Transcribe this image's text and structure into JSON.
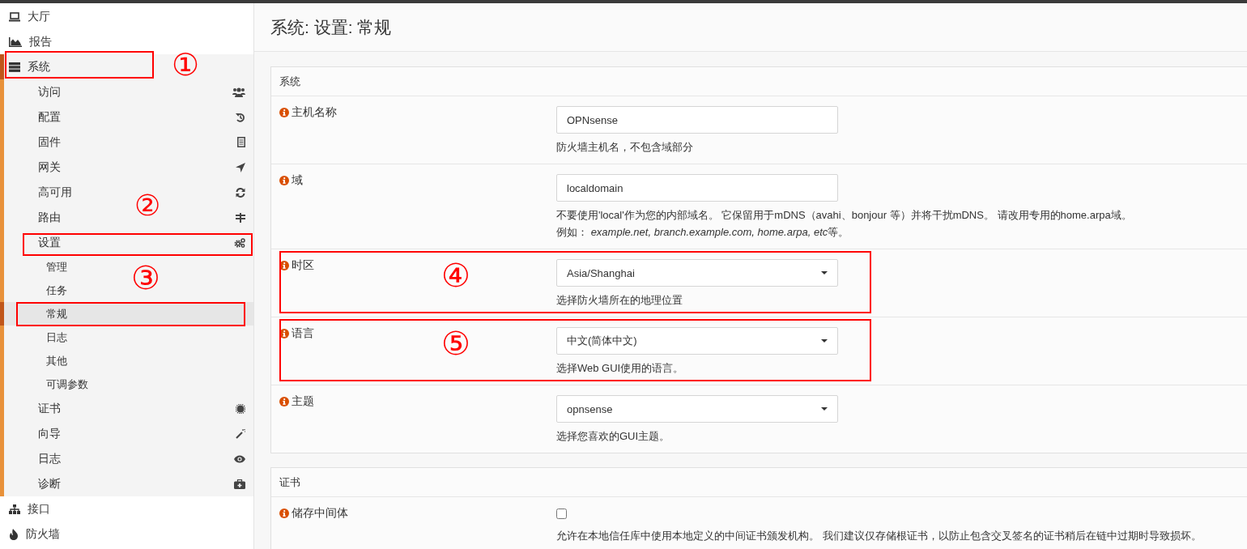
{
  "sidebar": {
    "items": [
      {
        "label": "大厅",
        "selected": false
      },
      {
        "label": "报告",
        "selected": false
      },
      {
        "label": "系统",
        "selected": true,
        "expanded": true,
        "callout": "①",
        "children": [
          {
            "label": "访问",
            "selected": false
          },
          {
            "label": "配置",
            "selected": false
          },
          {
            "label": "固件",
            "selected": false
          },
          {
            "label": "网关",
            "selected": false
          },
          {
            "label": "高可用",
            "selected": false
          },
          {
            "label": "路由",
            "selected": false
          },
          {
            "label": "设置",
            "selected": false,
            "expanded": true,
            "callout": "②",
            "children": [
              {
                "label": "管理",
                "selected": false
              },
              {
                "label": "任务",
                "selected": false
              },
              {
                "label": "常规",
                "selected": true,
                "callout": "③"
              },
              {
                "label": "日志",
                "selected": false
              },
              {
                "label": "其他",
                "selected": false
              },
              {
                "label": "可调参数",
                "selected": false
              }
            ]
          },
          {
            "label": "证书",
            "selected": false
          },
          {
            "label": "向导",
            "selected": false
          },
          {
            "label": "日志",
            "selected": false
          },
          {
            "label": "诊断",
            "selected": false
          }
        ]
      },
      {
        "label": "接口",
        "selected": false
      },
      {
        "label": "防火墙",
        "selected": false
      }
    ]
  },
  "page_title": "系统: 设置: 常规",
  "sections": [
    {
      "title": "系统",
      "rows": [
        {
          "label": "主机名称",
          "kind": "text",
          "value": "OPNsense",
          "help": [
            "防火墙主机名，不包含域部分"
          ]
        },
        {
          "label": "域",
          "kind": "text",
          "value": "localdomain",
          "help": [
            "不要使用'local'作为您的内部域名。 它保留用于mDNS（avahi、bonjour 等）并将干扰mDNS。 请改用专用的home.arpa域。",
            {
              "parts": [
                {
                  "text": "例如： ",
                  "italic": false
                },
                {
                  "text": "example.net, branch.example.com, home.arpa, etc",
                  "italic": true
                },
                {
                  "text": "等。",
                  "italic": false
                }
              ]
            }
          ]
        },
        {
          "label": "时区",
          "kind": "select",
          "value": "Asia/Shanghai",
          "callout": "④",
          "help": [
            "选择防火墙所在的地理位置"
          ]
        },
        {
          "label": "语言",
          "kind": "select",
          "value": "中文(简体中文)",
          "callout": "⑤",
          "help": [
            "选择Web GUI使用的语言。"
          ]
        },
        {
          "label": "主题",
          "kind": "select",
          "value": "opnsense",
          "help": [
            "选择您喜欢的GUI主题。"
          ]
        }
      ]
    },
    {
      "title": "证书",
      "rows": [
        {
          "label": "储存中间体",
          "kind": "checkbox",
          "checked": false,
          "help": [
            "允许在本地信任库中使用本地定义的中间证书颁发机构。 我们建议仅存储根证书，以防止包含交叉签名的证书稍后在链中过期时导致损坏。"
          ]
        }
      ]
    }
  ]
}
